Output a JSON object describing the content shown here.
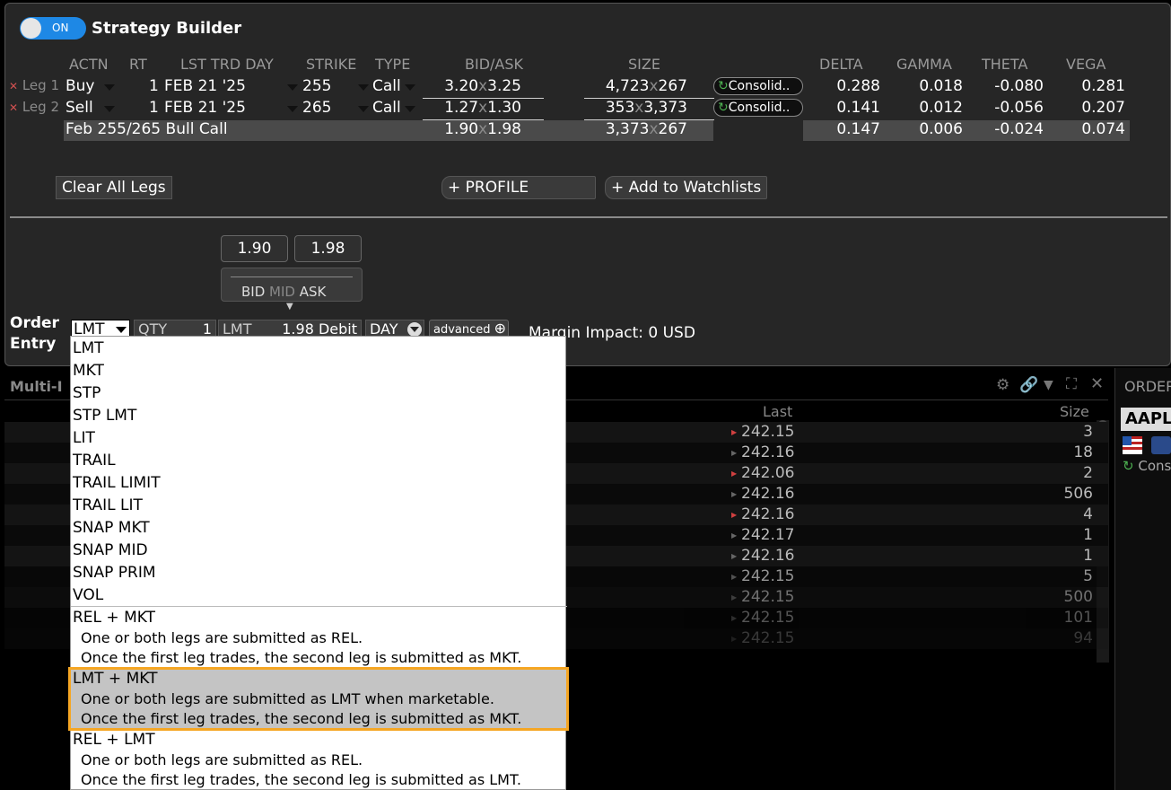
{
  "builder": {
    "toggle_label": "ON",
    "title": "Strategy Builder",
    "headers": [
      "ACTN",
      "RT",
      "LST TRD DAY",
      "STRIKE",
      "TYPE",
      "BID/ASK",
      "SIZE",
      "DELTA",
      "GAMMA",
      "THETA",
      "VEGA"
    ],
    "legs": [
      {
        "label": "Leg 1",
        "action": "Buy",
        "ratio": "1",
        "date": "FEB 21 '25",
        "strike": "255",
        "type": "Call",
        "bid": "3.20",
        "ask": "3.25",
        "size_bid": "4,723",
        "size_ask": "267",
        "exchange": "Consolid..",
        "delta": "0.288",
        "gamma": "0.018",
        "theta": "-0.080",
        "vega": "0.281"
      },
      {
        "label": "Leg 2",
        "action": "Sell",
        "ratio": "1",
        "date": "FEB 21 '25",
        "strike": "265",
        "type": "Call",
        "bid": "1.27",
        "ask": "1.30",
        "size_bid": "353",
        "size_ask": "3,373",
        "exchange": "Consolid..",
        "delta": "0.141",
        "gamma": "0.012",
        "theta": "-0.056",
        "vega": "0.207"
      }
    ],
    "combo": {
      "name": "Feb 255/265 Bull Call",
      "bid": "1.90",
      "ask": "1.98",
      "size_bid": "3,373",
      "size_ask": "267",
      "delta": "0.147",
      "gamma": "0.006",
      "theta": "-0.024",
      "vega": "0.074"
    },
    "x_sep": "x",
    "clear_label": "Clear All Legs",
    "profile_label": "PROFILE",
    "watchlist_label": "Add to Watchlists"
  },
  "order": {
    "bid_price": "1.90",
    "ask_price": "1.98",
    "slider_bid": "BID",
    "slider_mid": "MID",
    "slider_ask": "ASK",
    "label_line1": "Order",
    "label_line2": "Entry",
    "order_type": "LMT",
    "qty_label": "QTY",
    "qty_value": "1",
    "lmt_label": "LMT",
    "lmt_value": "1.98 Debit",
    "tif": "DAY",
    "advanced_label": "advanced",
    "margin": "Margin Impact: 0 USD"
  },
  "lower": {
    "tab_title": "Multi-I",
    "col_last": "Last",
    "col_size": "Size",
    "rows": [
      {
        "last": "242.15",
        "size": "3"
      },
      {
        "last": "242.16",
        "size": "18"
      },
      {
        "last": "242.06",
        "size": "2"
      },
      {
        "last": "242.16",
        "size": "506"
      },
      {
        "last": "242.16",
        "size": "4"
      },
      {
        "last": "242.17",
        "size": "1"
      },
      {
        "last": "242.16",
        "size": "1"
      },
      {
        "last": "242.15",
        "size": "5"
      },
      {
        "last": "242.15",
        "size": "500"
      },
      {
        "last": "242.15",
        "size": "101"
      },
      {
        "last": "242.15",
        "size": "94"
      }
    ],
    "right_title": "ORDER",
    "right_symbol": "AAPL",
    "right_cons": "Cons"
  },
  "dropdown": {
    "simple": [
      "LMT",
      "MKT",
      "STP",
      "STP LMT",
      "LIT",
      "TRAIL",
      "TRAIL LIMIT",
      "TRAIL LIT",
      "SNAP MKT",
      "SNAP MID",
      "SNAP PRIM",
      "VOL"
    ],
    "combo": [
      {
        "name": "REL + MKT",
        "line1": "One or both legs are submitted as REL.",
        "line2": "Once the first leg trades, the second leg is submitted as MKT."
      },
      {
        "name": "LMT + MKT",
        "line1": "One or both legs are submitted as LMT when marketable.",
        "line2": "Once the first leg trades, the second leg is submitted as MKT."
      },
      {
        "name": "REL + LMT",
        "line1": "One or both legs are submitted as REL.",
        "line2": "Once the first leg trades, the second leg is submitted as LMT."
      }
    ]
  }
}
